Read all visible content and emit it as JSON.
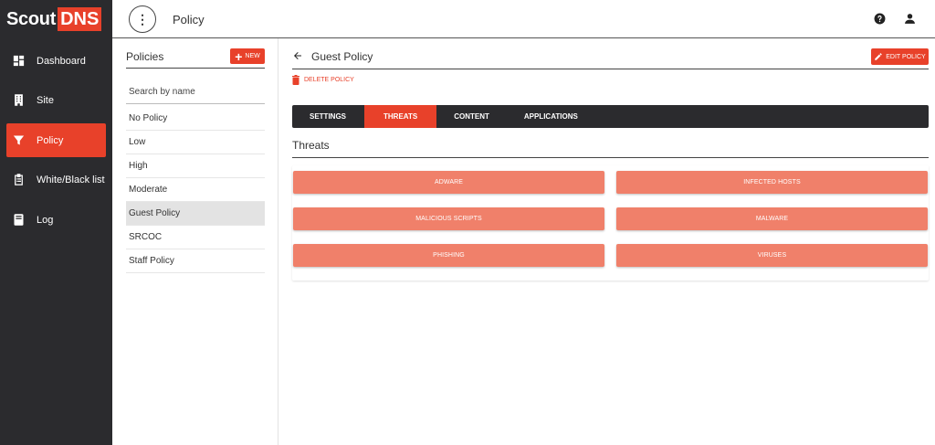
{
  "brand": {
    "part1": "Scout",
    "part2": "DNS"
  },
  "colors": {
    "accent": "#e8412a",
    "threat_button": "#f0806a",
    "sidebar_bg": "#2b2b2e"
  },
  "sidebar": {
    "items": [
      {
        "label": "Dashboard",
        "icon": "dashboard-icon",
        "active": false
      },
      {
        "label": "Site",
        "icon": "building-icon",
        "active": false
      },
      {
        "label": "Policy",
        "icon": "filter-icon",
        "active": true
      },
      {
        "label": "White/Black list",
        "icon": "clipboard-icon",
        "active": false
      },
      {
        "label": "Log",
        "icon": "book-icon",
        "active": false
      }
    ]
  },
  "topbar": {
    "title": "Policy",
    "menu_icon": "more-vert-icon",
    "help_icon": "help-icon",
    "user_icon": "user-icon"
  },
  "policies": {
    "title": "Policies",
    "new_label": "NEW",
    "search_placeholder": "Search by name",
    "items": [
      "No Policy",
      "Low",
      "High",
      "Moderate",
      "Guest Policy",
      "SRCOC",
      "Staff Policy"
    ],
    "selected": "Guest Policy"
  },
  "detail": {
    "title": "Guest Policy",
    "edit_label": "EDIT POLICY",
    "delete_label": "DELETE POLICY",
    "tabs": [
      "SETTINGS",
      "THREATS",
      "CONTENT",
      "APPLICATIONS"
    ],
    "active_tab": "THREATS",
    "section_title": "Threats",
    "threats": [
      "ADWARE",
      "INFECTED HOSTS",
      "MALICIOUS SCRIPTS",
      "MALWARE",
      "PHISHING",
      "VIRUSES"
    ]
  }
}
